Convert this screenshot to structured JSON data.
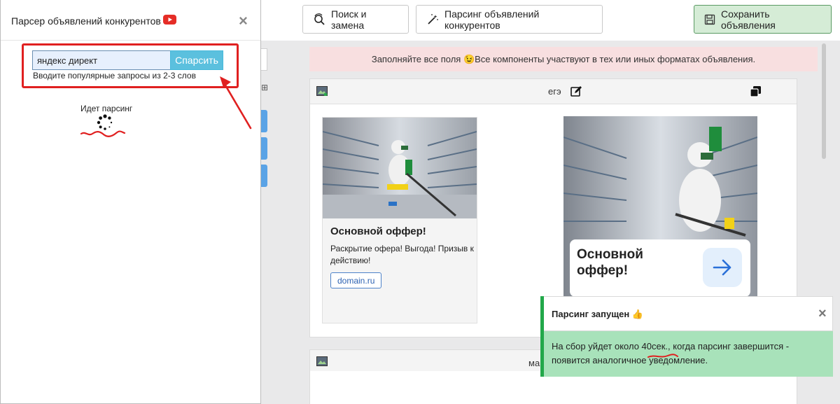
{
  "toolbar": {
    "search_replace_label": "Поиск и замена",
    "parse_competitors_label": "Парсинг объявлений конкурентов",
    "save_label": "Сохранить объявления"
  },
  "banner": {
    "text": "Заполняйте все поля 😉Все компоненты участвуют в тех или иных форматах объявления."
  },
  "ad_card": {
    "title": "егэ",
    "preview_small": {
      "headline": "Основной оффер!",
      "text": "Раскрытие офера! Выгода! Призыв к действию!",
      "domain": "domain.ru"
    },
    "preview_large": {
      "headline": "Основной оффер!"
    }
  },
  "ad_card2": {
    "title": "ма"
  },
  "modal": {
    "title": "Парсер объявлений конкурентов",
    "query_value": "яндекс директ",
    "parse_button": "Спарсить",
    "hint": "Вводите популярные запросы из 2-3 слов",
    "status": "Идет парсинг"
  },
  "toast": {
    "title": "Парсинг запущен 👍",
    "body": "На сбор уйдет около 40сек., когда парсинг завершится - появится аналогичное уведомление."
  },
  "colors": {
    "accent_info": "#5bc0de",
    "success": "#22a84a",
    "annotation_red": "#e02020"
  }
}
